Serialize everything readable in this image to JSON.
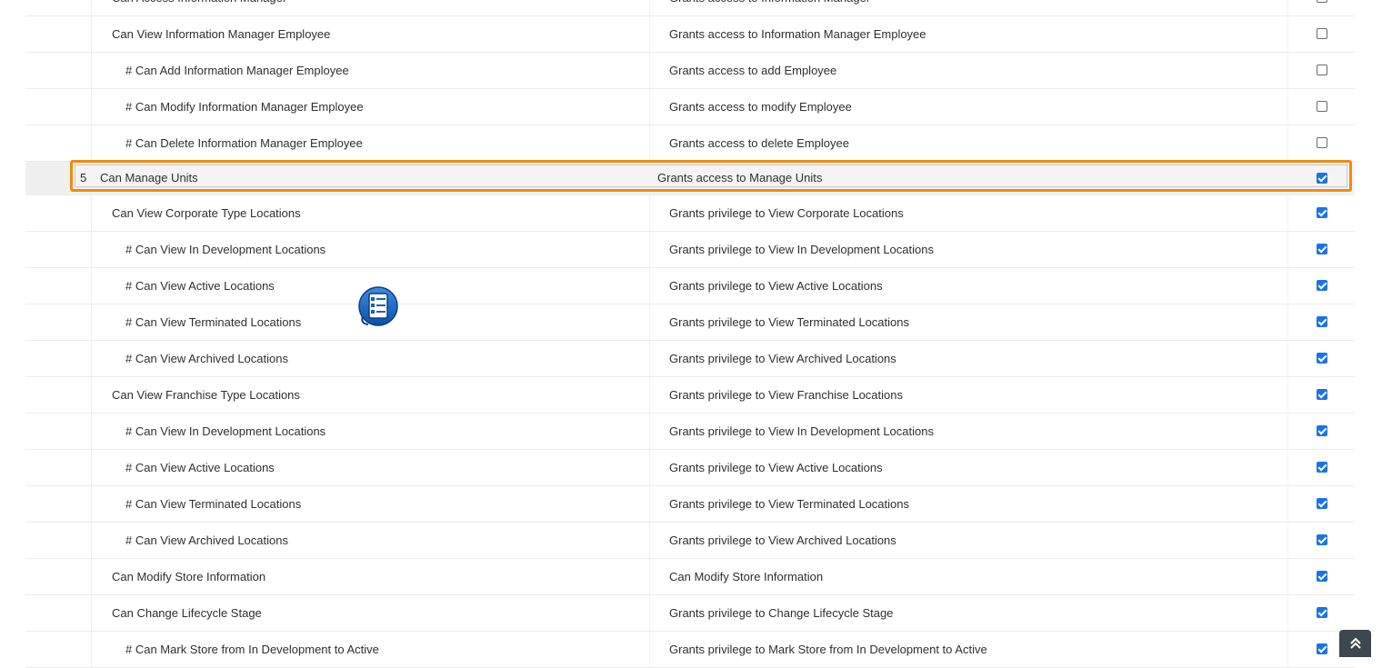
{
  "rows": [
    {
      "name": "Can Access Information Manager",
      "desc": "Grants access to Information Manager",
      "checked": false,
      "sub": false
    },
    {
      "name": "Can View Information Manager Employee",
      "desc": "Grants access to Information Manager Employee",
      "checked": false,
      "sub": false
    },
    {
      "name": "# Can Add Information Manager Employee",
      "desc": "Grants access to add Employee",
      "checked": false,
      "sub": true
    },
    {
      "name": "# Can Modify Information Manager Employee",
      "desc": "Grants access to modify Employee",
      "checked": false,
      "sub": true
    },
    {
      "name": "# Can Delete Information Manager Employee",
      "desc": "Grants access to delete Employee",
      "checked": false,
      "sub": true
    },
    {
      "group": true,
      "index": "5",
      "name": "Can Manage Units",
      "desc": "Grants access to Manage Units",
      "checked": true
    },
    {
      "name": "Can View Corporate Type Locations",
      "desc": "Grants privilege to View Corporate Locations",
      "checked": true,
      "sub": false
    },
    {
      "name": "# Can View In Development Locations",
      "desc": "Grants privilege to View In Development Locations",
      "checked": true,
      "sub": true
    },
    {
      "name": "# Can View Active Locations",
      "desc": "Grants privilege to View Active Locations",
      "checked": true,
      "sub": true
    },
    {
      "name": "# Can View Terminated Locations",
      "desc": "Grants privilege to View Terminated Locations",
      "checked": true,
      "sub": true
    },
    {
      "name": "# Can View Archived Locations",
      "desc": "Grants privilege to View Archived Locations",
      "checked": true,
      "sub": true
    },
    {
      "name": "Can View Franchise Type Locations",
      "desc": "Grants privilege to View Franchise Locations",
      "checked": true,
      "sub": false
    },
    {
      "name": "# Can View In Development Locations",
      "desc": "Grants privilege to View In Development Locations",
      "checked": true,
      "sub": true
    },
    {
      "name": "# Can View Active Locations",
      "desc": "Grants privilege to View Active Locations",
      "checked": true,
      "sub": true
    },
    {
      "name": "# Can View Terminated Locations",
      "desc": "Grants privilege to View Terminated Locations",
      "checked": true,
      "sub": true
    },
    {
      "name": "# Can View Archived Locations",
      "desc": "Grants privilege to View Archived Locations",
      "checked": true,
      "sub": true
    },
    {
      "name": "Can Modify Store Information",
      "desc": "Can Modify Store Information",
      "checked": true,
      "sub": false
    },
    {
      "name": "Can Change Lifecycle Stage",
      "desc": "Grants privilege to Change Lifecycle Stage",
      "checked": true,
      "sub": false
    },
    {
      "name": "# Can Mark Store from In Development to Active",
      "desc": "Grants privilege to Mark Store from In Development to Active",
      "checked": true,
      "sub": true
    }
  ],
  "icons": {
    "step_marker": "numbered-list-icon",
    "scroll_top": "double-chevron-up-icon"
  },
  "colors": {
    "highlight": "#f48a0e",
    "checkbox_checked": "#1a73e8"
  }
}
